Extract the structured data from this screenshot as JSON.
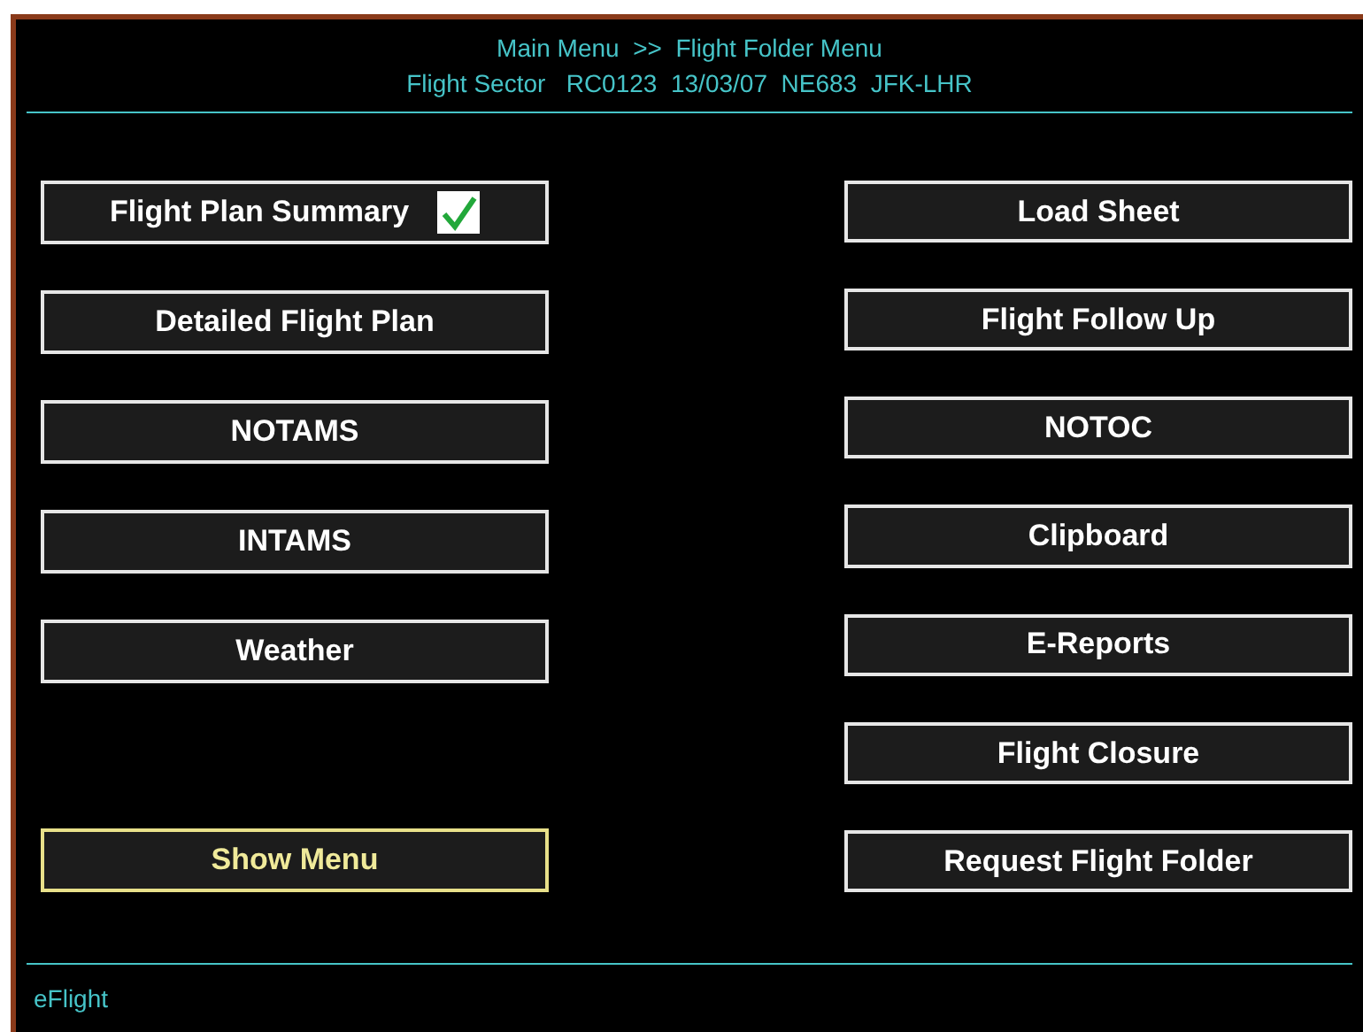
{
  "header": {
    "breadcrumb": "Main Menu  >>  Flight Folder Menu",
    "sector": "Flight Sector   RC0123  13/03/07  NE683  JFK-LHR"
  },
  "left_buttons": [
    {
      "label": "Flight Plan Summary",
      "checked": true
    },
    {
      "label": "Detailed Flight Plan",
      "checked": false
    },
    {
      "label": "NOTAMS",
      "checked": false
    },
    {
      "label": "INTAMS",
      "checked": false
    },
    {
      "label": "Weather",
      "checked": false
    }
  ],
  "show_menu": {
    "label": "Show Menu",
    "selected": true
  },
  "right_buttons": [
    {
      "label": "Load Sheet",
      "checked": false
    },
    {
      "label": "Flight Follow Up",
      "checked": false
    },
    {
      "label": "NOTOC",
      "checked": false
    },
    {
      "label": "Clipboard",
      "checked": false
    },
    {
      "label": "E-Reports",
      "checked": false
    },
    {
      "label": "Flight Closure",
      "checked": false
    },
    {
      "label": "Request Flight Folder",
      "checked": false
    }
  ],
  "footer": "eFlight"
}
